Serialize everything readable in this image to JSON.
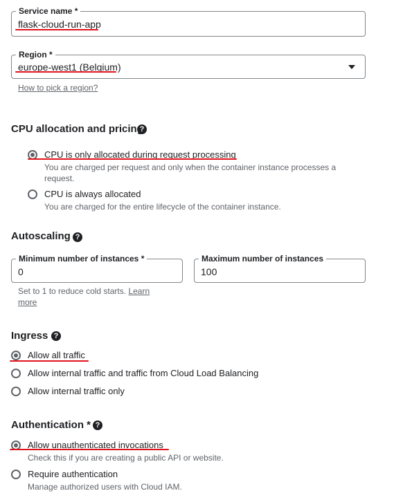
{
  "service_name": {
    "label": "Service name *",
    "value": "flask-cloud-run-app"
  },
  "region": {
    "label": "Region *",
    "value": "europe-west1 (Belgium)",
    "help_link": "How to pick a region?"
  },
  "cpu": {
    "title": "CPU allocation and pricing",
    "options": [
      {
        "label": "CPU is only allocated during request processing",
        "desc": "You are charged per request and only when the container instance processes a request.",
        "selected": true
      },
      {
        "label": "CPU is always allocated",
        "desc": "You are charged for the entire lifecycle of the container instance.",
        "selected": false
      }
    ]
  },
  "autoscaling": {
    "title": "Autoscaling",
    "min": {
      "label": "Minimum number of instances *",
      "value": "0"
    },
    "max": {
      "label": "Maximum number of instances",
      "value": "100"
    },
    "hint": "Set to 1 to reduce cold starts.",
    "hint_link": "Learn more"
  },
  "ingress": {
    "title": "Ingress",
    "options": [
      {
        "label": "Allow all traffic",
        "selected": true
      },
      {
        "label": "Allow internal traffic and traffic from Cloud Load Balancing",
        "selected": false
      },
      {
        "label": "Allow internal traffic only",
        "selected": false
      }
    ]
  },
  "authentication": {
    "title": "Authentication *",
    "options": [
      {
        "label": "Allow unauthenticated invocations",
        "desc": "Check this if you are creating a public API or website.",
        "selected": true
      },
      {
        "label": "Require authentication",
        "desc": "Manage authorized users with Cloud IAM.",
        "selected": false
      }
    ]
  },
  "annotation_color": "#e0131a"
}
